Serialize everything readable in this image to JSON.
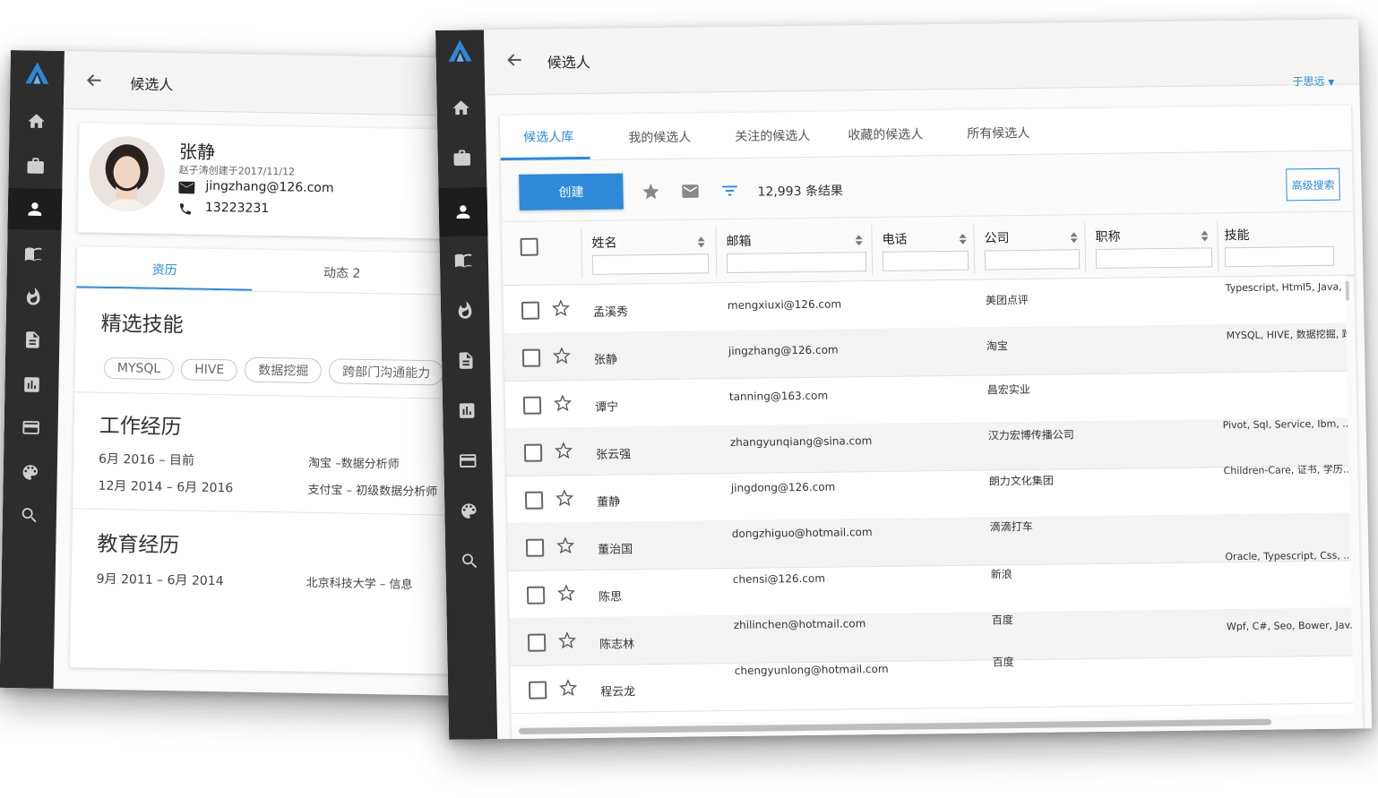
{
  "left_window": {
    "title": "候选人",
    "profile": {
      "name": "张静",
      "created": "赵子涛创建于2017/11/12",
      "email": "jingzhang@126.com",
      "phone": "13223231"
    },
    "tabs": [
      "资历",
      "动态 2"
    ],
    "skills_title": "精选技能",
    "skills": [
      "MYSQL",
      "HIVE",
      "数据挖掘",
      "跨部门沟通能力"
    ],
    "work_title": "工作经历",
    "work": [
      {
        "period": "6月 2016 – 目前",
        "desc": "淘宝 –数据分析师"
      },
      {
        "period": "12月 2014 – 6月 2016",
        "desc": "支付宝 – 初级数据分析师"
      }
    ],
    "edu_title": "教育经历",
    "edu": [
      {
        "period": "9月 2011 – 6月 2014",
        "desc": "北京科技大学 – 信息"
      }
    ]
  },
  "right_window": {
    "title": "候选人",
    "user": "于思远",
    "tabs": [
      "候选人库",
      "我的候选人",
      "关注的候选人",
      "收藏的候选人",
      "所有候选人"
    ],
    "create_label": "创建",
    "result_count": "12,993 条结果",
    "advanced_search": "高级搜索",
    "columns": [
      "姓名",
      "邮箱",
      "电话",
      "公司",
      "职称",
      "技能"
    ],
    "rows": [
      {
        "name": "孟溪秀",
        "email": "mengxiuxi@126.com",
        "company": "美团点评",
        "skills": "Typescript, Html5, Java, ..."
      },
      {
        "name": "张静",
        "email": "jingzhang@126.com",
        "company": "淘宝",
        "skills": "MYSQL, HIVE, 数据挖掘, 跨部"
      },
      {
        "name": "谭宁",
        "email": "tanning@163.com",
        "company": "昌宏实业",
        "skills": ""
      },
      {
        "name": "张云强",
        "email": "zhangyunqiang@sina.com",
        "company": "汉力宏博传播公司",
        "skills": "Pivot, Sql, Service, Ibm, ..."
      },
      {
        "name": "董静",
        "email": "jingdong@126.com",
        "company": "朗力文化集团",
        "skills": "Children-Care, 证书, 学历..."
      },
      {
        "name": "董治国",
        "email": "dongzhiguo@hotmail.com",
        "company": "滴滴打车",
        "skills": ""
      },
      {
        "name": "陈思",
        "email": "chensi@126.com",
        "company": "新浪",
        "skills": "Oracle, Typescript, Css, ..."
      },
      {
        "name": "陈志林",
        "email": "zhilinchen@hotmail.com",
        "company": "百度",
        "skills": ""
      },
      {
        "name": "程云龙",
        "email": "chengyunlong@hotmail.com",
        "company": "百度",
        "skills": "Wpf, C#, Seo, Bower, Jav..."
      }
    ]
  },
  "colors": {
    "accent": "#2e8ad8",
    "sidebar": "#2d2d2d",
    "logo": "#2e8ad8"
  },
  "icons": [
    "logo-icon",
    "home-icon",
    "briefcase-icon",
    "person-icon",
    "book-icon",
    "fire-icon",
    "document-icon",
    "bar-chart-icon",
    "card-icon",
    "palette-icon",
    "search-icon"
  ]
}
